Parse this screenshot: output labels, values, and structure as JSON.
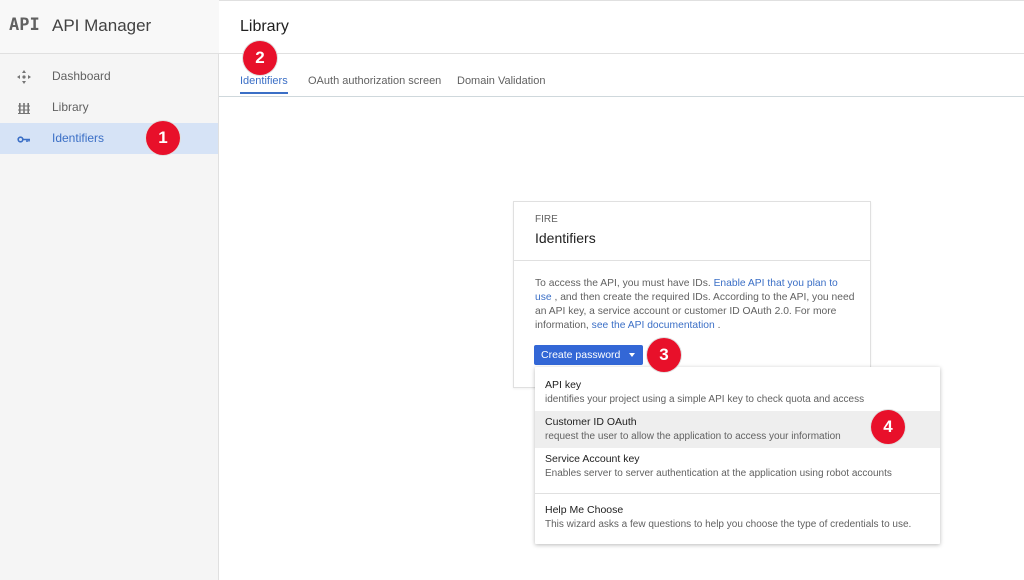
{
  "brand": {
    "logo": "API",
    "title": "API Manager"
  },
  "sidebar": {
    "items": [
      {
        "label": "Dashboard",
        "icon": "dashboard-icon",
        "active": false
      },
      {
        "label": "Library",
        "icon": "library-icon",
        "active": false
      },
      {
        "label": "Identifiers",
        "icon": "key-icon",
        "active": true
      }
    ]
  },
  "header": {
    "title": "Library"
  },
  "tabs": [
    {
      "label": "Identifiers",
      "active": true
    },
    {
      "label": "OAuth authorization screen",
      "active": false
    },
    {
      "label": "Domain Validation",
      "active": false
    }
  ],
  "card": {
    "eyebrow": "FIRE",
    "title": "Identifiers",
    "body_prefix": "To access the API, you must have IDs. ",
    "body_link1": "Enable API that you plan to use",
    "body_middle": " , and then create the required IDs. According to the API, you need an API key, a service account or customer ID OAuth 2.0. For more information, ",
    "body_link2": "see the API documentation",
    "body_suffix": " ."
  },
  "create_button": {
    "label": "Create password"
  },
  "menu": {
    "items": [
      {
        "title": "API key",
        "description": "identifies your project using a simple API key to check quota and access"
      },
      {
        "title": "Customer ID OAuth",
        "description": "request the user to allow the application to access your information"
      },
      {
        "title": "Service Account key",
        "description": "Enables server to server authentication at the application using robot accounts"
      },
      {
        "title": "Help Me Choose",
        "description": "This wizard asks a few questions to help you choose the type of credentials to use."
      }
    ]
  },
  "steps": [
    "1",
    "2",
    "3",
    "4"
  ],
  "colors": {
    "accent": "#3b6fc6",
    "button": "#3367d6",
    "active_nav_bg": "#d6e3f6",
    "step_marker": "#e8102a"
  }
}
